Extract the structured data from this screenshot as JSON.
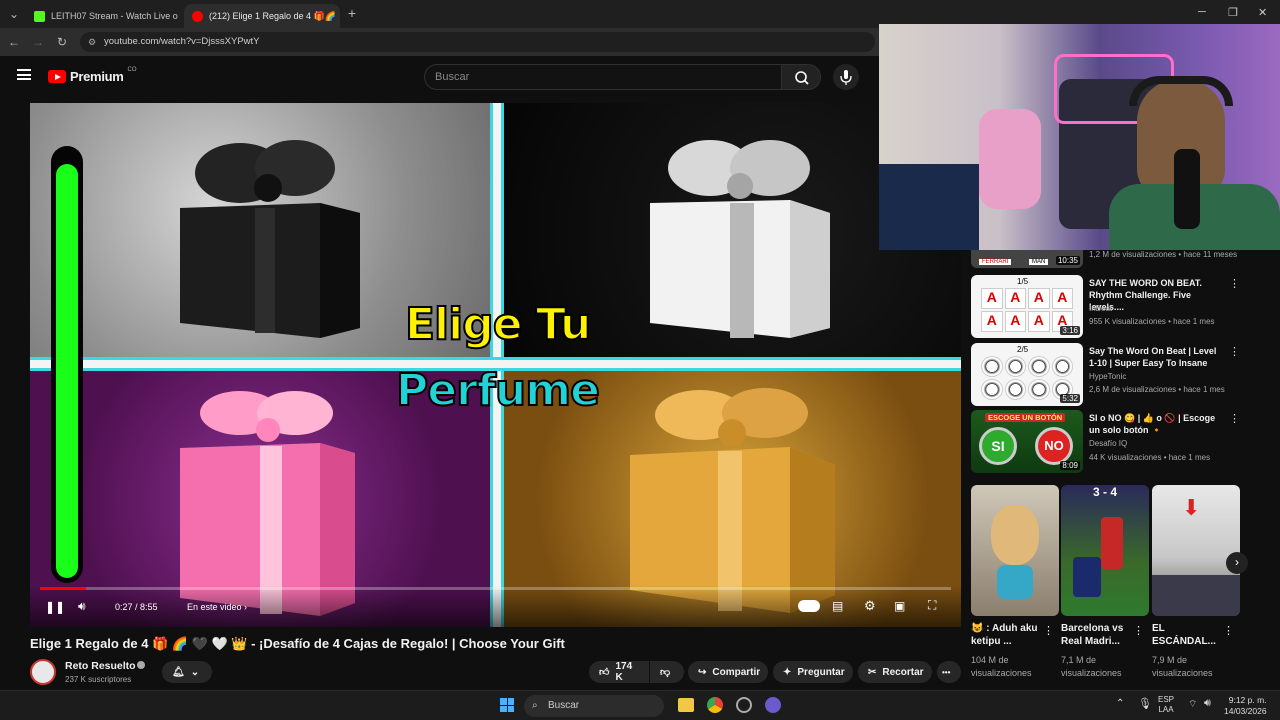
{
  "browser": {
    "tabs": [
      {
        "label": "LEITH07 Stream - Watch Live o",
        "favicon_color": "#53fc18"
      },
      {
        "label": "(212) Elige 1 Regalo de 4 🎁🌈",
        "favicon_color": "#ff0000"
      }
    ],
    "new_tab": "+",
    "url": "youtube.com/watch?v=DjsssXYPwtY"
  },
  "youtube": {
    "logo_text": "Premium",
    "country": "CO",
    "search_placeholder": "Buscar"
  },
  "video": {
    "overlay_line1": "Elige Tu",
    "overlay_line2": "Perfume",
    "time": "0:27 / 8:55",
    "chapter": "En este video",
    "progress_fraction": 0.05,
    "timer_bar_fraction": 0.97
  },
  "watch": {
    "title": "Elige 1 Regalo de 4 🎁 🌈 🖤 🤍 👑 - ¡Desafío de 4 Cajas de Regalo! | Choose Your Gift",
    "channel": "Reto Resuelto",
    "subscribers": "237 K suscriptores",
    "likes": "174 K",
    "share": "Compartir",
    "ask": "Preguntar",
    "clip": "Recortar",
    "more": "•••"
  },
  "sidebar": {
    "partial_top": {
      "meta": "1,2 M de visualizaciones • hace 11 meses",
      "duration": "10:35",
      "thumb_labels": [
        "FERRARI",
        "MAN"
      ]
    },
    "recs": [
      {
        "title": "SAY THE WORD ON BEAT. Rhythm Challenge. Five levels....",
        "channel": "InBeat",
        "meta": "955 K visualizaciones • hace 1 mes",
        "duration": "3:16",
        "thumb_label": "1/5"
      },
      {
        "title": "Say The Word On Beat | Level 1-10 | Super Easy To Insane",
        "channel": "HypeTonic",
        "meta": "2,6 M de visualizaciones • hace 1 mes",
        "duration": "5:32",
        "thumb_label": "2/5"
      },
      {
        "title": "SI o NO 😋 | 👍 o 🚫 | Escoge un solo botón 🔸",
        "channel": "Desafío IQ",
        "meta": "44 K visualizaciones • hace 1 mes",
        "duration": "8:09",
        "thumb_label": "ESCOGE UN BOTÓN",
        "yes": "SI",
        "no": "NO"
      }
    ],
    "shorts": [
      {
        "title": "😺 : Aduh aku ketipu ...",
        "meta": "104 M de visualizaciones"
      },
      {
        "title": "Barcelona vs Real Madri...",
        "meta": "7,1 M de visualizaciones",
        "score": "3 - 4"
      },
      {
        "title": "EL ESCÁNDAL...",
        "meta": "7,9 M de visualizaciones"
      }
    ]
  },
  "taskbar": {
    "search": "Buscar",
    "lang1": "ESP",
    "lang2": "LAA",
    "time": "9:12 p. m.",
    "date": "14/03/2026"
  },
  "colors": {
    "youtube_red": "#ff0000",
    "timer_green": "#1aff1a",
    "title_yellow": "#fff200",
    "title_cyan": "#22d3d6"
  }
}
